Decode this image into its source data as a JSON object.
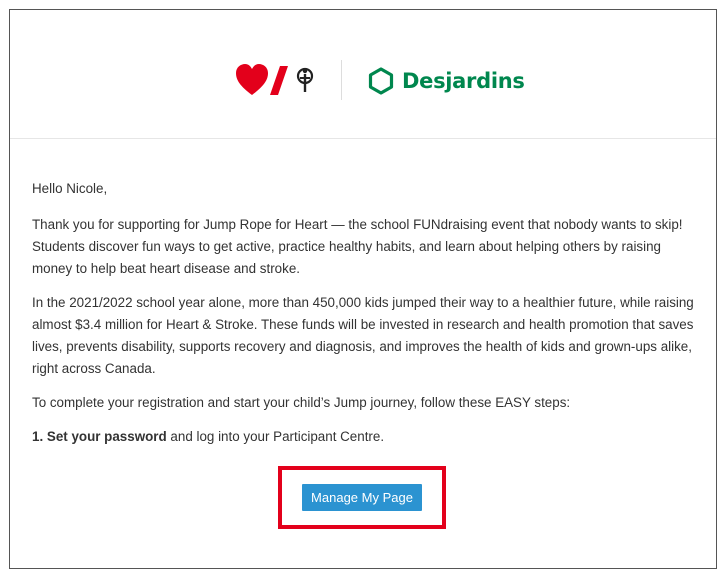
{
  "header": {
    "brand_name": "Desjardins"
  },
  "email": {
    "greeting": "Hello Nicole,",
    "paragraph1": "Thank you for supporting for Jump Rope for Heart — the school FUNdraising event that nobody wants to skip! Students discover fun ways to get active, practice healthy habits, and learn about helping others by raising money to help beat heart disease and stroke.",
    "paragraph2": "In the 2021/2022 school year alone, more than 450,000 kids jumped their way to a healthier future, while raising almost $3.4 million for Heart & Stroke. These funds will be invested in research and health promotion that saves lives, prevents disability, supports recovery and diagnosis, and improves the health of kids and grown-ups alike, right across Canada.",
    "paragraph3": "To complete your registration and start your child’s Jump journey, follow these EASY steps:",
    "step1_bold": "1. Set your password",
    "step1_rest": " and log into your Participant Centre.",
    "button_label": "Manage My Page"
  },
  "colors": {
    "heart_red": "#e3001b",
    "desjardins_green": "#00874e",
    "button_blue": "#2b93d1",
    "highlight_red": "#e3001b"
  },
  "icons": [
    "heart-and-stroke-logo",
    "desjardins-hexagon-icon"
  ]
}
